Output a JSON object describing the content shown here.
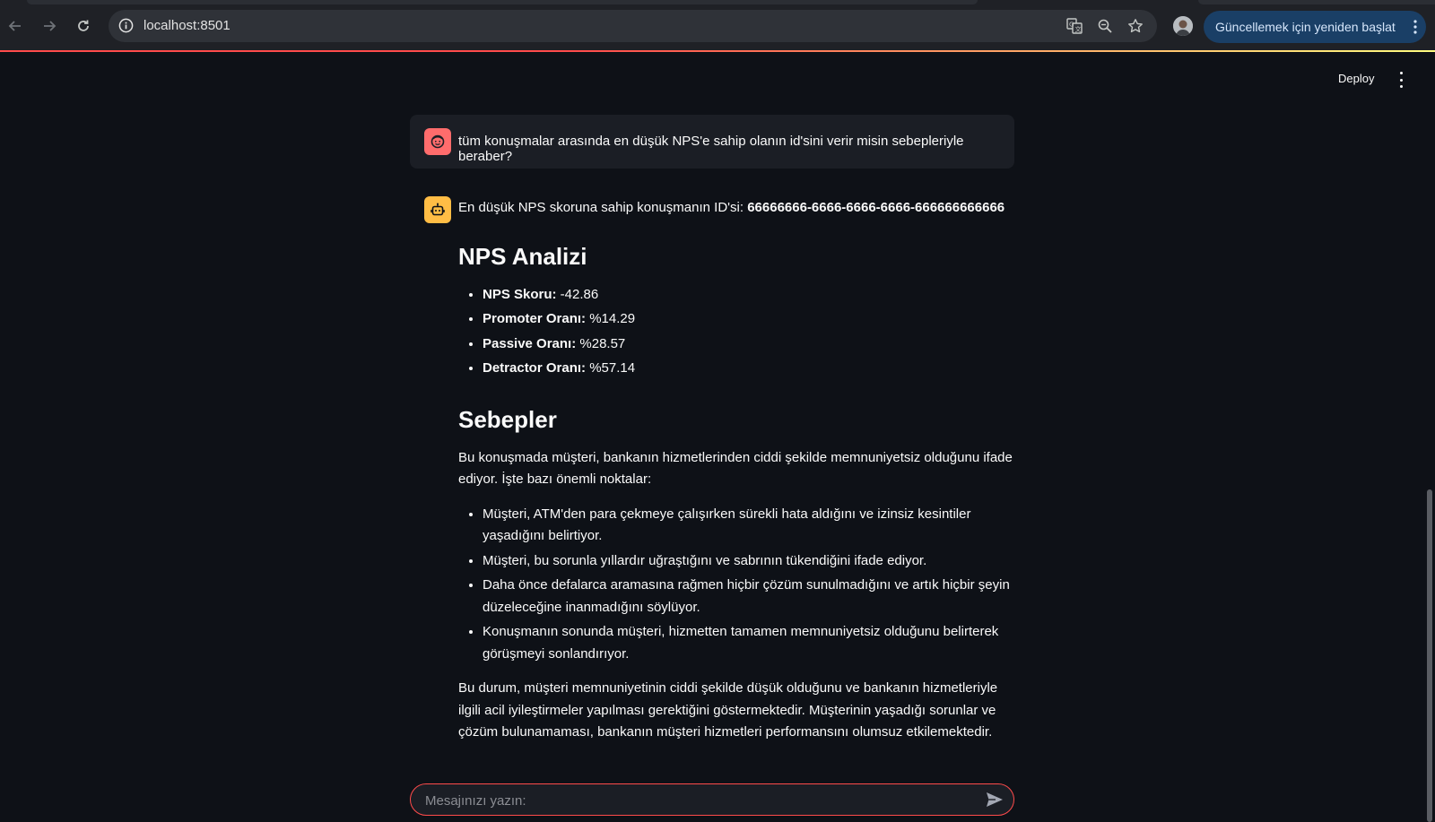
{
  "browser": {
    "url": "localhost:8501",
    "update_button_label": "Güncellemek için yeniden başlat"
  },
  "header": {
    "deploy_label": "Deploy"
  },
  "chat": {
    "user_message": "tüm konuşmalar arasında en düşük NPS'e sahip olanın id'sini verir misin sebepleriyle beraber?",
    "bot": {
      "intro_prefix": "En düşük NPS skoruna sahip konuşmanın ID'si: ",
      "conversation_id": "66666666-6666-6666-6666-666666666666",
      "nps_heading": "NPS Analizi",
      "metrics": [
        {
          "label": "NPS Skoru:",
          "value": " -42.86"
        },
        {
          "label": "Promoter Oranı:",
          "value": " %14.29"
        },
        {
          "label": "Passive Oranı:",
          "value": " %28.57"
        },
        {
          "label": "Detractor Oranı:",
          "value": " %57.14"
        }
      ],
      "reasons_heading": "Sebepler",
      "reasons_intro": "Bu konuşmada müşteri, bankanın hizmetlerinden ciddi şekilde memnuniyetsiz olduğunu ifade ediyor. İşte bazı önemli noktalar:",
      "reasons": [
        "Müşteri, ATM'den para çekmeye çalışırken sürekli hata aldığını ve izinsiz kesintiler yaşadığını belirtiyor.",
        "Müşteri, bu sorunla yıllardır uğraştığını ve sabrının tükendiğini ifade ediyor.",
        "Daha önce defalarca aramasına rağmen hiçbir çözüm sunulmadığını ve artık hiçbir şeyin düzeleceğine inanmadığını söylüyor.",
        "Konuşmanın sonunda müşteri, hizmetten tamamen memnuniyetsiz olduğunu belirterek görüşmeyi sonlandırıyor."
      ],
      "conclusion": "Bu durum, müşteri memnuniyetinin ciddi şekilde düşük olduğunu ve bankanın hizmetleriyle ilgili acil iyileştirmeler yapılması gerektiğini göstermektedir. Müşterinin yaşadığı sorunlar ve çözüm bulunamaması, bankanın müşteri hizmetleri performansını olumsuz etkilemektedir."
    }
  },
  "chat_input": {
    "placeholder": "Mesajınızı yazın:",
    "value": ""
  },
  "icons": {
    "back": "arrow-left-icon",
    "forward": "arrow-right-icon",
    "reload": "reload-icon",
    "site_info": "info-icon",
    "translate": "translate-icon",
    "zoom": "zoom-icon",
    "bookmark": "star-icon",
    "send": "send-icon",
    "user_avatar": "user-face-icon",
    "bot_avatar": "robot-icon"
  },
  "colors": {
    "app_background": "#0e1117",
    "user_avatar_bg": "#ff6c6c",
    "bot_avatar_bg": "#ffbd45",
    "input_border": "#ff4b4b",
    "update_button_bg": "#1a3f66"
  }
}
